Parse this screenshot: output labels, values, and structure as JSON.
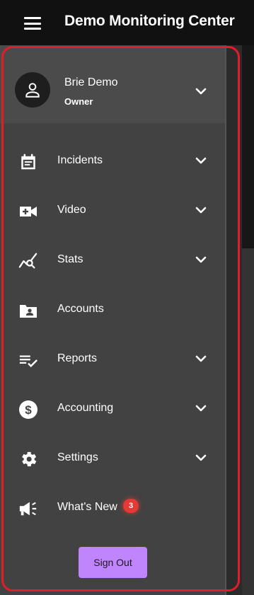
{
  "header": {
    "title": "Demo Monitoring Center",
    "menu_icon": "hamburger-icon"
  },
  "profile": {
    "name": "Brie Demo",
    "role": "Owner",
    "avatar_icon": "person-icon",
    "expand_icon": "chevron-down-icon"
  },
  "menu": {
    "items": [
      {
        "label": "Incidents",
        "icon": "calendar-list-icon",
        "expandable": true
      },
      {
        "label": "Video",
        "icon": "video-plus-icon",
        "expandable": true
      },
      {
        "label": "Stats",
        "icon": "chart-search-icon",
        "expandable": true
      },
      {
        "label": "Accounts",
        "icon": "folder-user-icon",
        "expandable": false
      },
      {
        "label": "Reports",
        "icon": "list-check-icon",
        "expandable": true
      },
      {
        "label": "Accounting",
        "icon": "dollar-circle-icon",
        "expandable": true
      },
      {
        "label": "Settings",
        "icon": "gear-icon",
        "expandable": true
      },
      {
        "label": "What's New",
        "icon": "megaphone-icon",
        "expandable": false,
        "badge": "3"
      }
    ]
  },
  "sign_out_label": "Sign Out",
  "colors": {
    "topbar": "#111111",
    "drawer": "#424242",
    "profile_bg": "#4b4b4b",
    "accent_button": "#c084fc",
    "badge": "#e53935",
    "highlight_border": "#e11d2a"
  }
}
